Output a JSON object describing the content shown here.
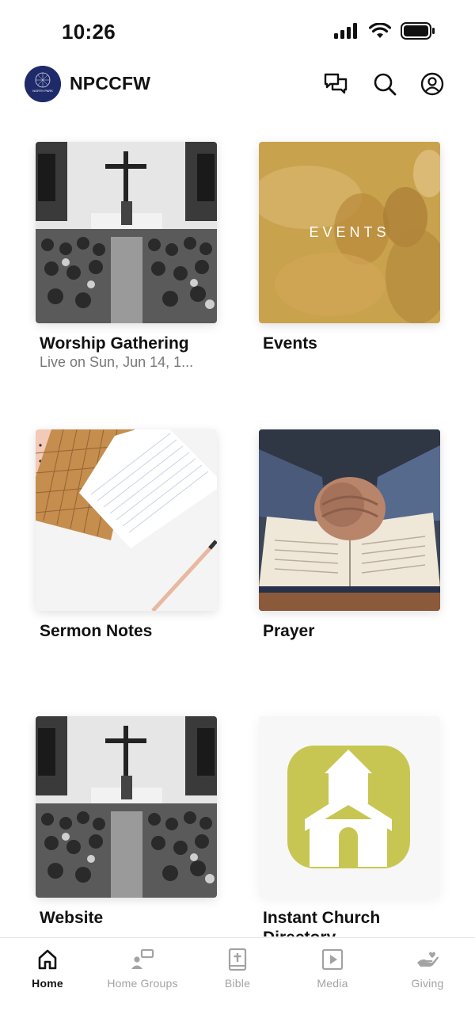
{
  "status_bar": {
    "time": "10:26"
  },
  "header": {
    "title": "NPCCFW",
    "avatar_text": "NORTH PARK"
  },
  "tiles": [
    {
      "title": "Worship Gathering",
      "subtitle": "Live on Sun, Jun 14, 1..."
    },
    {
      "title": "Events",
      "overlay_text": "EVENTS"
    },
    {
      "title": "Sermon Notes"
    },
    {
      "title": "Prayer"
    },
    {
      "title": "Website"
    },
    {
      "title": "Instant Church Directory"
    }
  ],
  "tabs": [
    {
      "label": "Home",
      "icon": "home-icon",
      "active": true
    },
    {
      "label": "Home Groups",
      "icon": "groups-icon",
      "active": false
    },
    {
      "label": "Bible",
      "icon": "bible-icon",
      "active": false
    },
    {
      "label": "Media",
      "icon": "media-icon",
      "active": false
    },
    {
      "label": "Giving",
      "icon": "giving-icon",
      "active": false
    }
  ],
  "colors": {
    "avatar_bg": "#1f2a6b",
    "events_overlay": "#c9a24d",
    "directory_green": "#c7c653",
    "tab_active": "#111111",
    "tab_inactive": "#a3a3a3"
  }
}
